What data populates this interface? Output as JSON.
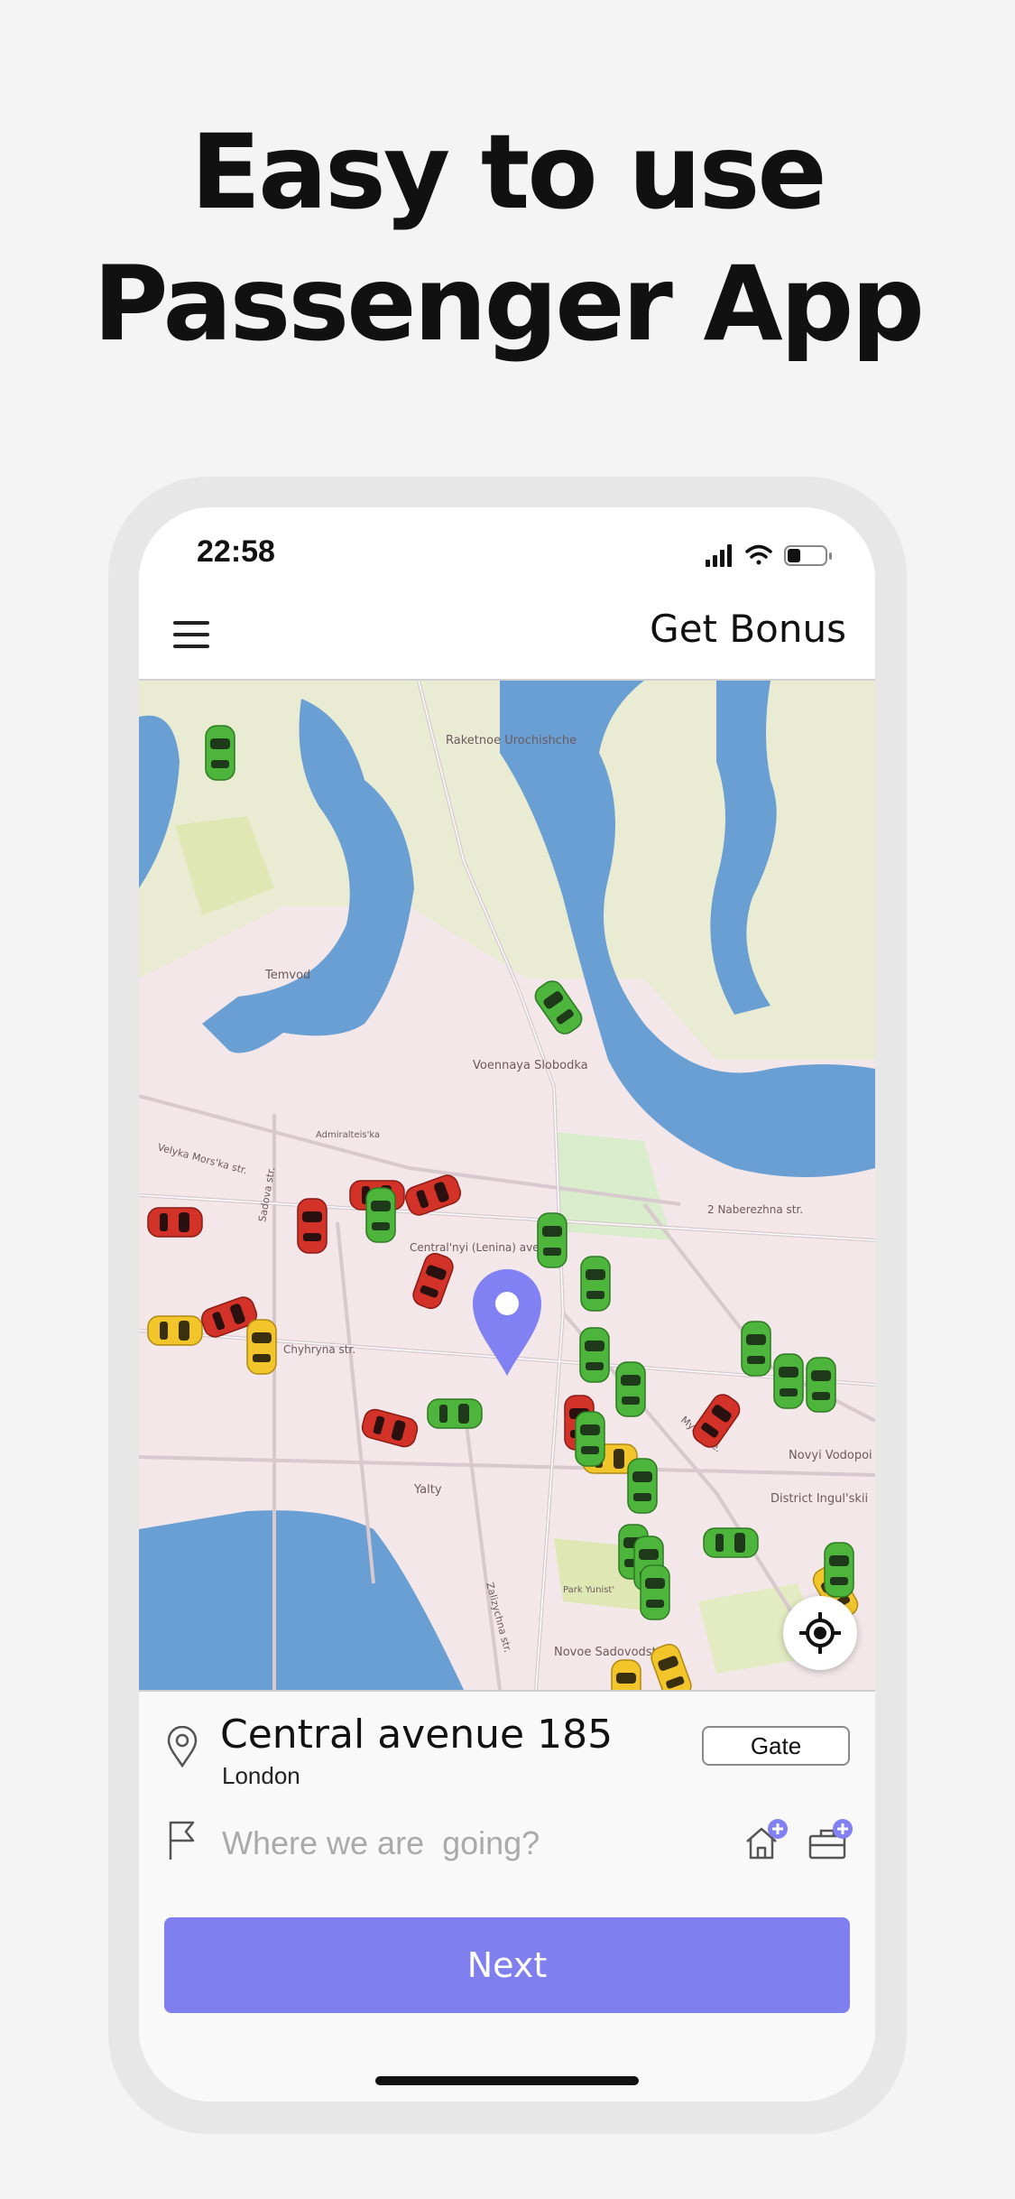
{
  "promo": {
    "headline_line1": "Easy to use",
    "headline_line2": "Passenger App"
  },
  "status_bar": {
    "time": "22:58",
    "icons": [
      "signal-icon",
      "wifi-icon",
      "battery-icon"
    ]
  },
  "app_bar": {
    "menu_icon": "hamburger-menu-icon",
    "bonus_label": "Get Bonus"
  },
  "map": {
    "labels": [
      "Raketnoe Urochishche",
      "Temvod",
      "Voennaya Slobodka",
      "Admiralteis'ka",
      "Central'nyi (Lenina) ave.",
      "Chyhryna str.",
      "Yalty",
      "Zalizychna str.",
      "2 Naberezhna str.",
      "Novyi Vodopoi",
      "District Ingul'skii",
      "Novoe Sadovodstvo",
      "Velyka Mors'ka str.",
      "Sadova str.",
      "Myru ave.",
      "Park Yunist'"
    ],
    "destination_pin_color": "#8181f3",
    "car_colors": {
      "green": "#4db53b",
      "red": "#d23228",
      "yellow": "#f2c52a"
    },
    "locate_icon": "crosshair-locate-icon"
  },
  "trip": {
    "pickup_icon": "location-pin-icon",
    "pickup_address": "Central avenue 185",
    "pickup_city": "London",
    "gate_label": "Gate",
    "destination_icon": "flag-icon",
    "destination_placeholder": "Where we are  going?",
    "destination_value": "",
    "home_shortcut_icon": "home-add-icon",
    "work_shortcut_icon": "briefcase-add-icon",
    "next_label": "Next"
  },
  "colors": {
    "accent": "#7f7ff0",
    "water": "#6a9fd4",
    "park": "#e8eec0"
  }
}
